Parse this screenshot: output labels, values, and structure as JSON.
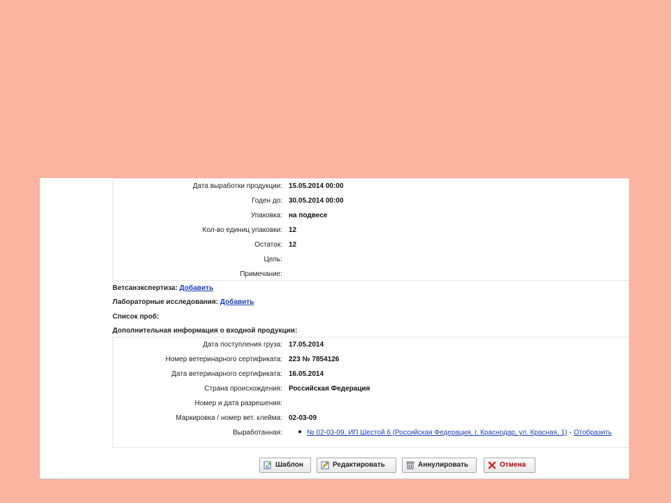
{
  "product_details": [
    {
      "label": "Дата выработки продукции:",
      "value": "15.05.2014 00:00"
    },
    {
      "label": "Годен до:",
      "value": "30.05.2014 00:00"
    },
    {
      "label": "Упаковка:",
      "value": "на подвесе"
    },
    {
      "label": "Кол-во единиц упаковки:",
      "value": "12"
    },
    {
      "label": "Остаток:",
      "value": "12"
    },
    {
      "label": "Цель:",
      "value": ""
    },
    {
      "label": "Примечание:",
      "value": ""
    }
  ],
  "sections": {
    "vet_expertise": {
      "label": "Ветсанэкспертиза:",
      "link": "Добавить"
    },
    "lab_research": {
      "label": "Лабораторные исследования:",
      "link": "Добавить"
    },
    "samples": {
      "label": "Список проб:"
    },
    "additional_info": {
      "label": "Дополнительная информация о входной продукции:"
    }
  },
  "incoming_details": [
    {
      "label": "Дата поступления груза:",
      "value": "17.05.2014"
    },
    {
      "label": "Номер ветеринарного сертификата:",
      "value": "223 № 7854126"
    },
    {
      "label": "Дата ветеринарного сертификата:",
      "value": "16.05.2014"
    },
    {
      "label": "Страна происхождения:",
      "value": "Российская Федерация"
    },
    {
      "label": "Номер и дата разрешения:",
      "value": ""
    },
    {
      "label": "Маркировка / номер вет. клейма:",
      "value": "02-03-09"
    }
  ],
  "produced": {
    "label": "Выработанная:",
    "link": "№ 02-03-09, ИП Шестой 6 (Российская Федерация, г. Краснодар, ул. Красная, 1)",
    "separator": "-",
    "action": "Отобразить"
  },
  "buttons": {
    "template": "Шаблон",
    "edit": "Редактировать",
    "annul": "Аннулировать",
    "cancel": "Отмена"
  }
}
